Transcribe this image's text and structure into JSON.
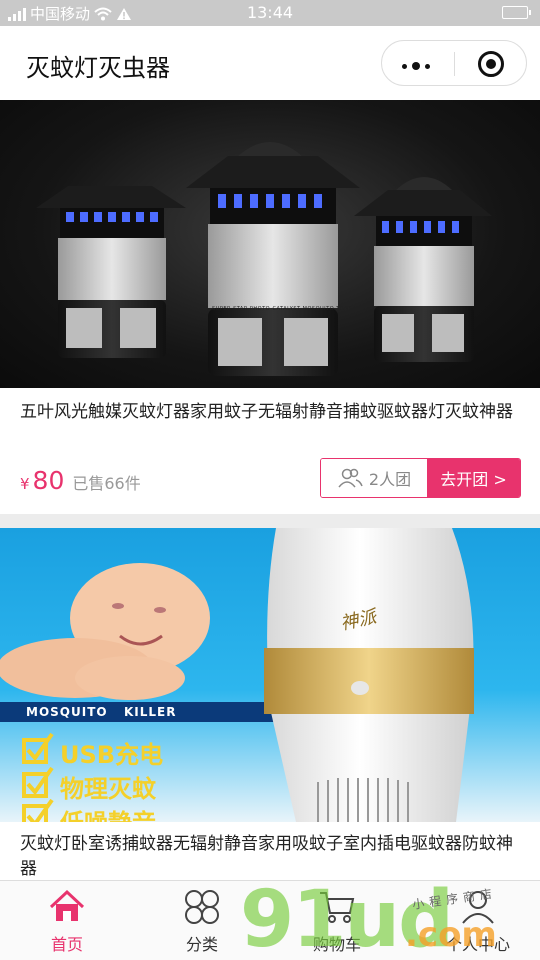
{
  "status_bar": {
    "carrier": "中国移动",
    "time": "13:44"
  },
  "nav": {
    "title": "灭蚊灯灭虫器"
  },
  "products": [
    {
      "name": "五叶风光触媒灭蚊灯器家用蚊子无辐射静音捕蚊驱蚊器灯灭蚊神器",
      "currency": "¥",
      "price": "80",
      "sold": "已售66件",
      "group_size": "2人团",
      "group_action": "去开团 >",
      "image_label": "SUPER STAR PHOTO-CATALYST MOSQUITO TRAP"
    },
    {
      "name": "灭蚊灯卧室诱捕蚊器无辐射静音家用吸蚊子室内插电驱蚊器防蚊神器",
      "image_text": {
        "banner_left": "MOSQUITO",
        "banner_right": "KILLER",
        "feature_1": "USB充电",
        "feature_2": "物理灭蚊",
        "feature_3": "低噪静音",
        "brand": "神派"
      }
    }
  ],
  "tabs": [
    {
      "label": "首页",
      "icon": "home-icon",
      "active": true
    },
    {
      "label": "分类",
      "icon": "category-icon",
      "active": false
    },
    {
      "label": "购物车",
      "icon": "cart-icon",
      "active": false
    },
    {
      "label": "个人中心",
      "icon": "user-icon",
      "active": false
    }
  ],
  "watermark": {
    "main": "91ud",
    "suffix": ".com",
    "handwriting": "小程序商店"
  },
  "colors": {
    "accent": "#e8336d",
    "status_bar": "#c9c9c9",
    "watermark_green": "#78cd3c",
    "watermark_orange": "#f5a028"
  }
}
